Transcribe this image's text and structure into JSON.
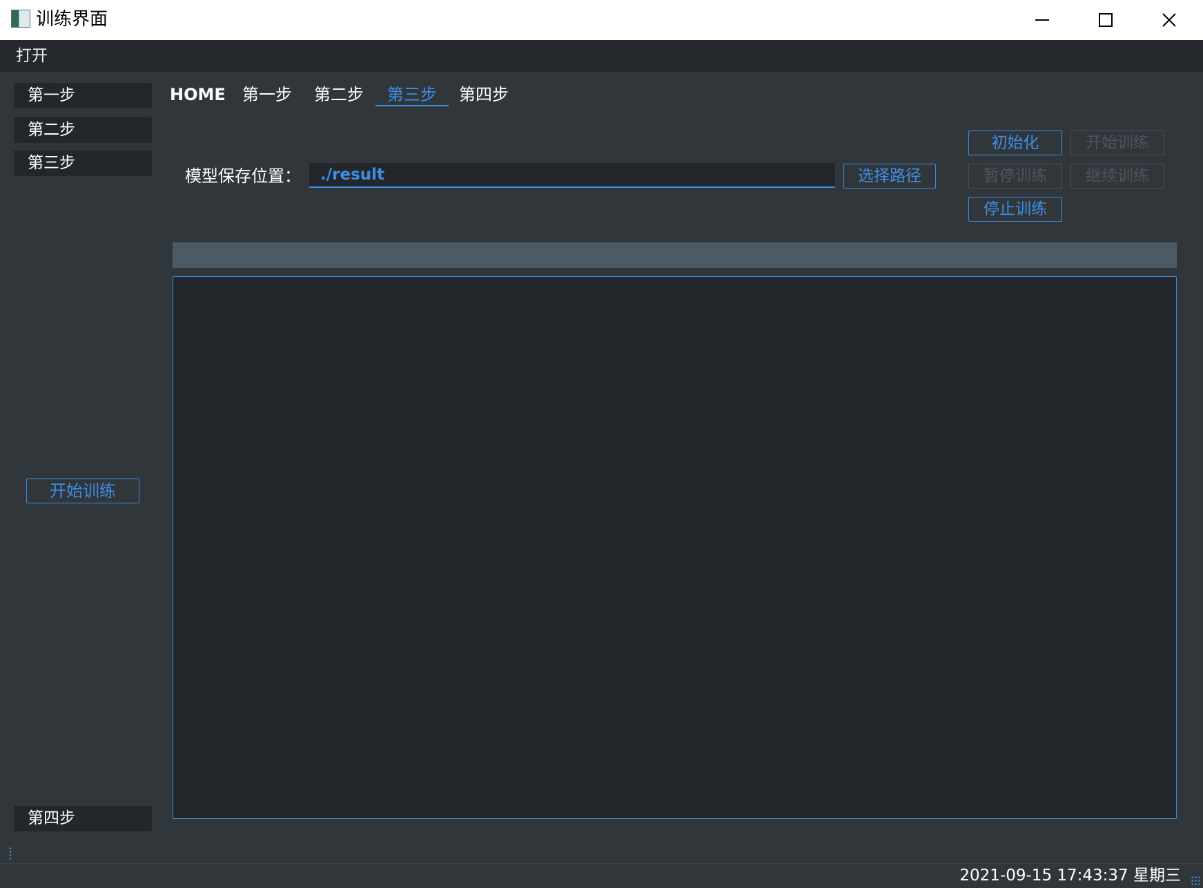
{
  "window": {
    "title": "训练界面",
    "minimize_glyph": "—",
    "maximize_glyph": "☐",
    "close_glyph": "✕"
  },
  "menu": {
    "open_label": "打开"
  },
  "sidebar": {
    "steps": [
      "第一步",
      "第二步",
      "第三步",
      "第四步"
    ],
    "start_button_label": "开始训练"
  },
  "tabs": {
    "items": [
      "HOME",
      "第一步",
      "第二步",
      "第三步",
      "第四步"
    ],
    "active_index": 3
  },
  "path": {
    "label": "模型保存位置：",
    "value": "./result",
    "choose_button_label": "选择路径"
  },
  "controls": {
    "init_label": "初始化",
    "start_label": "开始训练",
    "pause_label": "暂停训练",
    "resume_label": "继续训练",
    "stop_label": "停止训练"
  },
  "progress": {
    "value_percent": 0
  },
  "log": {
    "text": ""
  },
  "status": {
    "datetime": "2021-09-15 17:43:37 星期三"
  },
  "colors": {
    "accent": "#3d8ee6",
    "background": "#31363b",
    "panel": "#23272b",
    "menubar": "#25292e",
    "progress_track": "#4d5a64",
    "disabled": "#4d555d"
  }
}
